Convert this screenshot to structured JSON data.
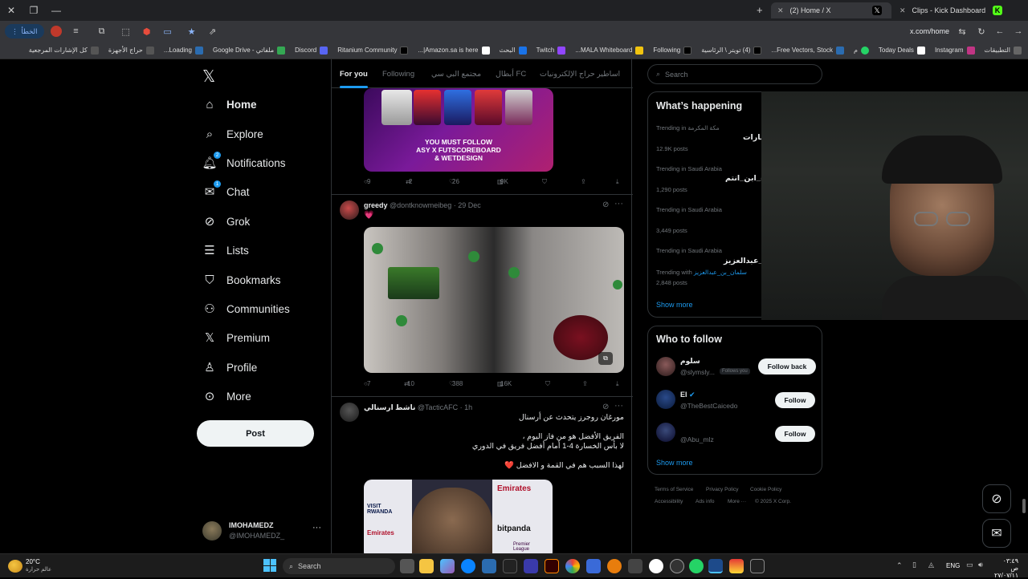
{
  "browser": {
    "tabs": [
      {
        "title": "(2) Home / X",
        "active": true
      },
      {
        "title": "Clips - Kick Dashboard",
        "active": false
      }
    ],
    "url": "x.com/home",
    "profile_label": "الخطأ",
    "bookmarks": [
      "التطبيقات",
      "Instagram",
      "Today Deals",
      "م",
      "Free Vectors, Stock...",
      "(4) تويتر \\ الرئاسية",
      "Following",
      "MALA Whiteboard...",
      "Twitch",
      "البحث",
      "Amazon.sa is here|...",
      "Ritanium Community",
      "Discord",
      "ملفاتي - Google Drive",
      "Loading...",
      "حراج الأجهزة",
      "كل الإشارات المرجعية"
    ]
  },
  "sidebar": {
    "items": [
      {
        "label": "Home",
        "icon": "home-icon"
      },
      {
        "label": "Explore",
        "icon": "search-icon"
      },
      {
        "label": "Notifications",
        "icon": "bell-icon",
        "badge": "2"
      },
      {
        "label": "Chat",
        "icon": "mail-icon",
        "badge": "1"
      },
      {
        "label": "Grok",
        "icon": "grok-icon"
      },
      {
        "label": "Lists",
        "icon": "list-icon"
      },
      {
        "label": "Bookmarks",
        "icon": "bookmark-icon"
      },
      {
        "label": "Communities",
        "icon": "people-icon"
      },
      {
        "label": "Premium",
        "icon": "x-logo-icon"
      },
      {
        "label": "Profile",
        "icon": "person-icon"
      },
      {
        "label": "More",
        "icon": "more-circle-icon"
      }
    ],
    "post_label": "Post",
    "account": {
      "name": "IMOHAMEDZ",
      "handle": "@IMOHAMEDZ_"
    }
  },
  "feed": {
    "tabs": [
      "For you",
      "Following",
      "مجتمع البي سي",
      "أبطال FC",
      "حراج الإلكترونيات",
      "اساطير"
    ],
    "post1": {
      "card_text1": "YOU MUST FOLLOW",
      "card_text2": "ASY X FUTSCOREBOARD",
      "card_text3": "& WETDESIGN",
      "replies": "9",
      "reposts": "2",
      "likes": "26",
      "views": "9K"
    },
    "post2": {
      "name": "greedy",
      "handle": "@dontknowmeibeg",
      "date": "· 29 Dec",
      "emoji": "💗",
      "replies": "7",
      "reposts": "10",
      "likes": "388",
      "views": "16K"
    },
    "post3": {
      "name": "ناشط ارسنالي",
      "handle": "@TacticAFC",
      "date": "· 1h",
      "line1": "مورغان روجرز يتحدث عن أرسنال",
      "line2": "الفريق الأفضل هو من فاز اليوم ،",
      "line3": "لا بأس الخسارة 4-1 أمام أفضل فريق في الدوري",
      "line4": "لهذا السبب هم في القمة و الافضل ❤️",
      "board1": "Emirates",
      "board2": "VISIT RWANDA",
      "board3": "bitpanda",
      "board4": "Premier League"
    }
  },
  "right": {
    "search_placeholder": "Search",
    "happening_title": "What’s happening",
    "trends": [
      {
        "meta": "Trending in مكة المكرمة",
        "name": "مارات",
        "count": "12.9K posts"
      },
      {
        "meta": "Trending in Saudi Arabia",
        "name": "ء_ابن_انتم",
        "count": "1,290 posts"
      },
      {
        "meta": "Trending in Saudi Arabia",
        "name": "",
        "count": "3,449 posts"
      },
      {
        "meta": "Trending in Saudi Arabia",
        "name": "عبدالعزيز_",
        "count": "2,848 posts",
        "with_label": "Trending with",
        "with_tag": "سلمان_بن_عبدالعزيز"
      }
    ],
    "show_more": "Show more",
    "who_title": "Who to follow",
    "suggestions": [
      {
        "name": "سلوم",
        "handle": "@slymsly...",
        "follows_you": "Follows you",
        "button": "Follow back"
      },
      {
        "name": "El",
        "handle": "@TheBestCaicedo",
        "button": "Follow"
      },
      {
        "name": "",
        "handle": "@Abu_mlz",
        "button": "Follow"
      }
    ],
    "footer": [
      "Terms of Service",
      "Privacy Policy",
      "Cookie Policy",
      "Accessibility",
      "Ads info",
      "More ···",
      "© 2025 X Corp."
    ]
  },
  "taskbar": {
    "weather_temp": "20°C",
    "weather_desc": "عالم حرارة",
    "search": "Search",
    "lang": "ENG",
    "time": "٠٣:٤٩ ص",
    "date": "٢٧/٠٧/١١"
  },
  "colors": {
    "accent": "#1d9bf0",
    "bg": "#000000",
    "border": "#2f3336",
    "muted": "#71767b"
  }
}
